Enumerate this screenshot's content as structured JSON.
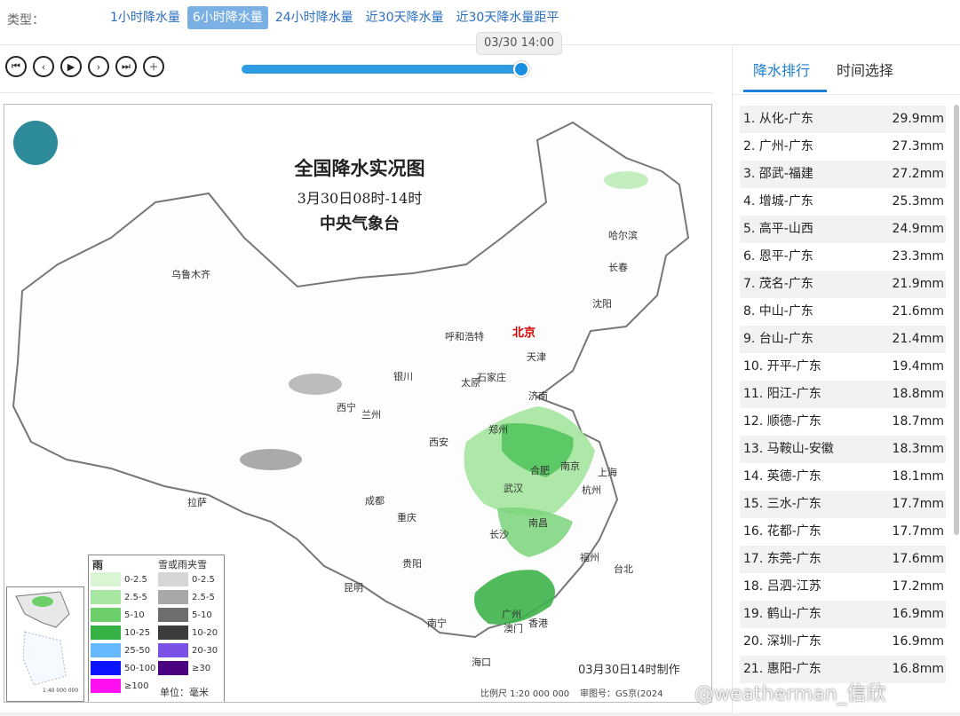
{
  "typebar": {
    "label": "类型：",
    "tabs": [
      "1小时降水量",
      "6小时降水量",
      "24小时降水量",
      "近30天降水量",
      "近30天降水量距平"
    ],
    "active_index": 1
  },
  "timeline": {
    "tooltip": "03/30 14:00",
    "progress": 1.0
  },
  "map": {
    "title": "全国降水实况图",
    "subtitle": "3月30日08时-14时",
    "org": "中央气象台",
    "made": "03月30日14时制作",
    "scale": "比例尺 1:20 000 000",
    "review": "审图号：GS京(2024",
    "cities": {
      "urumqi": "乌鲁木齐",
      "harbin": "哈尔滨",
      "changchun": "长春",
      "shenyang": "沈阳",
      "hohhot": "呼和浩特",
      "beijing": "北京",
      "tianjin": "天津",
      "yinchuan": "银川",
      "taiyuan": "太原",
      "shijiazhuang": "石家庄",
      "jinan": "济南",
      "xining": "西宁",
      "lanzhou": "兰州",
      "zhengzhou": "郑州",
      "xian": "西安",
      "hefei": "合肥",
      "nanjing": "南京",
      "shanghai": "上海",
      "lhasa": "拉萨",
      "wuhan": "武汉",
      "hangzhou": "杭州",
      "chengdu": "成都",
      "chongqing": "重庆",
      "nanchang": "南昌",
      "changsha": "长沙",
      "fuzhou": "福州",
      "taibei": "台北",
      "guiyang": "贵阳",
      "kunming": "昆明",
      "guangzhou": "广州",
      "aomen": "澳门",
      "xianggang": "香港",
      "nanning": "南宁",
      "haikou": "海口"
    },
    "legend": {
      "rain_title": "雨",
      "snow_title": "雪或雨夹雪",
      "unit": "单位：毫米",
      "rain": [
        {
          "label": "0-2.5",
          "color": "#d9f5d4"
        },
        {
          "label": "2.5-5",
          "color": "#a6e6a0"
        },
        {
          "label": "5-10",
          "color": "#6dcf6a"
        },
        {
          "label": "10-25",
          "color": "#36b244"
        },
        {
          "label": "25-50",
          "color": "#66b8ff"
        },
        {
          "label": "50-100",
          "color": "#0a14ff"
        },
        {
          "label": "≥100",
          "color": "#ff10f0"
        }
      ],
      "snow": [
        {
          "label": "0-2.5",
          "color": "#d6d6d6"
        },
        {
          "label": "2.5-5",
          "color": "#a8a8a8"
        },
        {
          "label": "5-10",
          "color": "#6e6e6e"
        },
        {
          "label": "10-20",
          "color": "#3c3c3c"
        },
        {
          "label": "20-30",
          "color": "#7a52e6"
        },
        {
          "label": "≥30",
          "color": "#4b0082"
        }
      ]
    },
    "inset_caption": "1:40 000 000"
  },
  "panel": {
    "tabs": [
      "降水排行",
      "时间选择"
    ],
    "active_index": 0,
    "ranking": [
      {
        "name": "1. 从化-广东",
        "value": "29.9mm"
      },
      {
        "name": "2. 广州-广东",
        "value": "27.3mm"
      },
      {
        "name": "3. 邵武-福建",
        "value": "27.2mm"
      },
      {
        "name": "4. 增城-广东",
        "value": "25.3mm"
      },
      {
        "name": "5. 高平-山西",
        "value": "24.9mm"
      },
      {
        "name": "6. 恩平-广东",
        "value": "23.3mm"
      },
      {
        "name": "7. 茂名-广东",
        "value": "21.9mm"
      },
      {
        "name": "8. 中山-广东",
        "value": "21.6mm"
      },
      {
        "name": "9. 台山-广东",
        "value": "21.4mm"
      },
      {
        "name": "10. 开平-广东",
        "value": "19.4mm"
      },
      {
        "name": "11. 阳江-广东",
        "value": "18.8mm"
      },
      {
        "name": "12. 顺德-广东",
        "value": "18.7mm"
      },
      {
        "name": "13. 马鞍山-安徽",
        "value": "18.3mm"
      },
      {
        "name": "14. 英德-广东",
        "value": "18.1mm"
      },
      {
        "name": "15. 三水-广东",
        "value": "17.7mm"
      },
      {
        "name": "16. 花都-广东",
        "value": "17.7mm"
      },
      {
        "name": "17. 东莞-广东",
        "value": "17.6mm"
      },
      {
        "name": "18. 吕泗-江苏",
        "value": "17.2mm"
      },
      {
        "name": "19. 鹤山-广东",
        "value": "16.9mm"
      },
      {
        "name": "20. 深圳-广东",
        "value": "16.9mm"
      },
      {
        "name": "21. 惠阳-广东",
        "value": "16.8mm"
      }
    ]
  },
  "watermark": "@weatherman_信欣"
}
